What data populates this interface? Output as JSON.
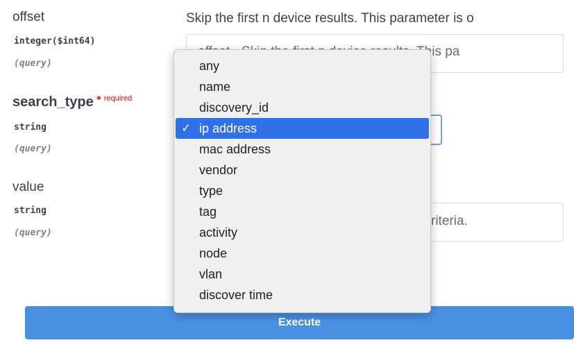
{
  "params": {
    "offset": {
      "name": "offset",
      "type": "integer($int64)",
      "in": "(query)",
      "description": "Skip the first n device results. This parameter is o",
      "placeholder": "offset - Skip the first n device results. This pa"
    },
    "search_type": {
      "name": "search_type",
      "required_mark": "*",
      "required_label": "required",
      "type": "string",
      "in": "(query)"
    },
    "value": {
      "name": "value",
      "type": "string",
      "in": "(query)",
      "placeholder_tail": "riteria."
    }
  },
  "dropdown": {
    "selected_index": 3,
    "check_glyph": "✓",
    "options": [
      "any",
      "name",
      "discovery_id",
      "ip address",
      "mac address",
      "vendor",
      "type",
      "tag",
      "activity",
      "node",
      "vlan",
      "discover time"
    ]
  },
  "execute_label": "Execute",
  "colors": {
    "accent": "#4990e2",
    "selected_option": "#2f6fe8",
    "required": "#ff0000"
  }
}
